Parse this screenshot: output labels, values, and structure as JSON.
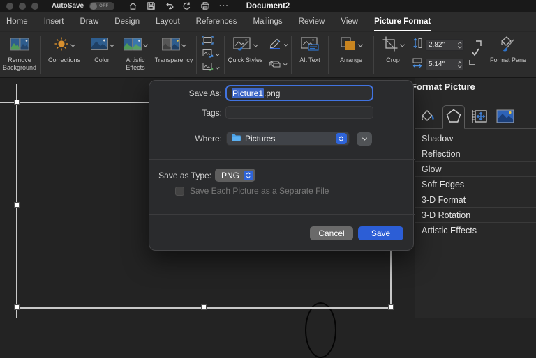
{
  "titlebar": {
    "autosave_label": "AutoSave",
    "autosave_state": "OFF",
    "document_title": "Document2"
  },
  "ribbon_tabs": [
    "Home",
    "Insert",
    "Draw",
    "Design",
    "Layout",
    "References",
    "Mailings",
    "Review",
    "View",
    "Picture Format"
  ],
  "ribbon": {
    "remove_background_label": "Remove Background",
    "corrections_label": "Corrections",
    "color_label": "Color",
    "artistic_effects_label": "Artistic Effects",
    "transparency_label": "Transparency",
    "quick_styles_label": "Quick Styles",
    "alt_text_label": "Alt Text",
    "arrange_label": "Arrange",
    "crop_label": "Crop",
    "height_value": "2.82\"",
    "width_value": "5.14\"",
    "format_pane_label": "Format Pane"
  },
  "dialog": {
    "save_as_label": "Save As:",
    "filename_selected": "Picture1",
    "filename_ext": ".png",
    "tags_label": "Tags:",
    "where_label": "Where:",
    "where_value": "Pictures",
    "type_label": "Save as Type:",
    "type_value": "PNG",
    "separate_checkbox_label": "Save Each Picture as a Separate File",
    "cancel_label": "Cancel",
    "save_label": "Save"
  },
  "panel": {
    "title": "Format Picture",
    "sections": [
      "Shadow",
      "Reflection",
      "Glow",
      "Soft Edges",
      "3-D Format",
      "3-D Rotation",
      "Artistic Effects"
    ]
  },
  "icons": {
    "ellipsis": "···"
  },
  "colors": {
    "accent_blue": "#2e64d9",
    "save_button_blue": "#2c5ed6",
    "selection_highlight": "#3c66c6",
    "arrange_orange": "#c8841f",
    "sun_orange": "#d78f2e"
  }
}
